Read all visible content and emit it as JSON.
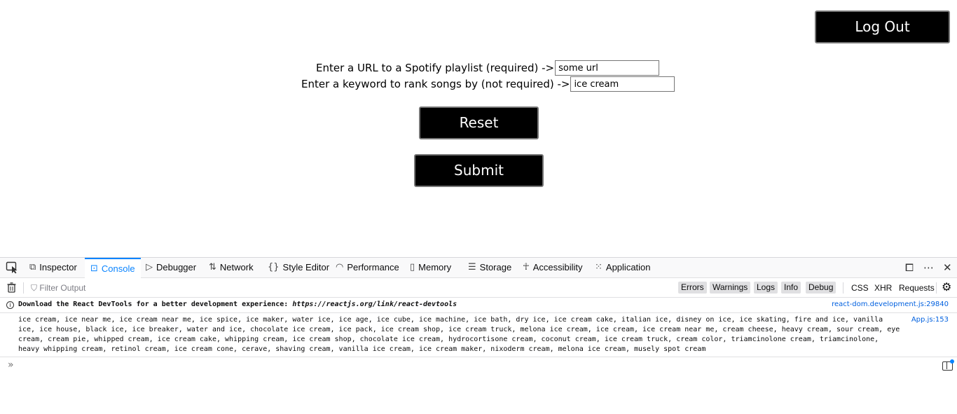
{
  "page": {
    "logout_label": "Log Out",
    "playlist_label": "Enter a URL to a Spotify playlist (required) ->",
    "playlist_value": "some url",
    "keyword_label": "Enter a keyword to rank songs by (not required) ->",
    "keyword_value": "ice cream",
    "reset_label": "Reset",
    "submit_label": "Submit"
  },
  "devtools": {
    "tabs": [
      {
        "label": "Inspector",
        "icon": "inspector-icon"
      },
      {
        "label": "Console",
        "icon": "console-icon",
        "active": true
      },
      {
        "label": "Debugger",
        "icon": "debugger-icon"
      },
      {
        "label": "Network",
        "icon": "network-icon"
      },
      {
        "label": "Style Editor",
        "icon": "style-editor-icon"
      },
      {
        "label": "Performance",
        "icon": "performance-icon"
      },
      {
        "label": "Memory",
        "icon": "memory-icon"
      },
      {
        "label": "Storage",
        "icon": "storage-icon"
      },
      {
        "label": "Accessibility",
        "icon": "accessibility-icon"
      },
      {
        "label": "Application",
        "icon": "application-icon"
      }
    ],
    "filter_placeholder": "Filter Output",
    "levels": [
      "Errors",
      "Warnings",
      "Logs",
      "Info",
      "Debug"
    ],
    "extras": [
      "CSS",
      "XHR",
      "Requests"
    ],
    "messages": {
      "info_prefix": "Download the React DevTools for a better development experience: ",
      "info_link": "https://reactjs.org/link/react-devtools",
      "info_source": "react-dom.development.js:29840",
      "log_text": "ice cream, ice near me, ice cream near me, ice spice, ice maker, water ice, ice age, ice cube, ice machine, ice bath, dry ice, ice cream cake, italian ice, disney on ice, ice skating, fire and ice, vanilla ice, ice house, black ice, ice breaker, water and ice, chocolate ice cream, ice pack, ice cream shop, ice cream truck, melona ice cream, ice cream, ice cream near me, cream cheese, heavy cream, sour cream, eye cream, cream pie, whipped cream, ice cream cake, whipping cream, ice cream shop, chocolate ice cream, hydrocortisone cream, coconut cream, ice cream truck, cream color, triamcinolone cream, triamcinolone, heavy whipping cream, retinol cream, ice cream cone, cerave, shaving cream, vanilla ice cream, ice cream maker, nixoderm cream, melona ice cream, musely spot cream",
      "log_source": "App.js:153"
    }
  }
}
